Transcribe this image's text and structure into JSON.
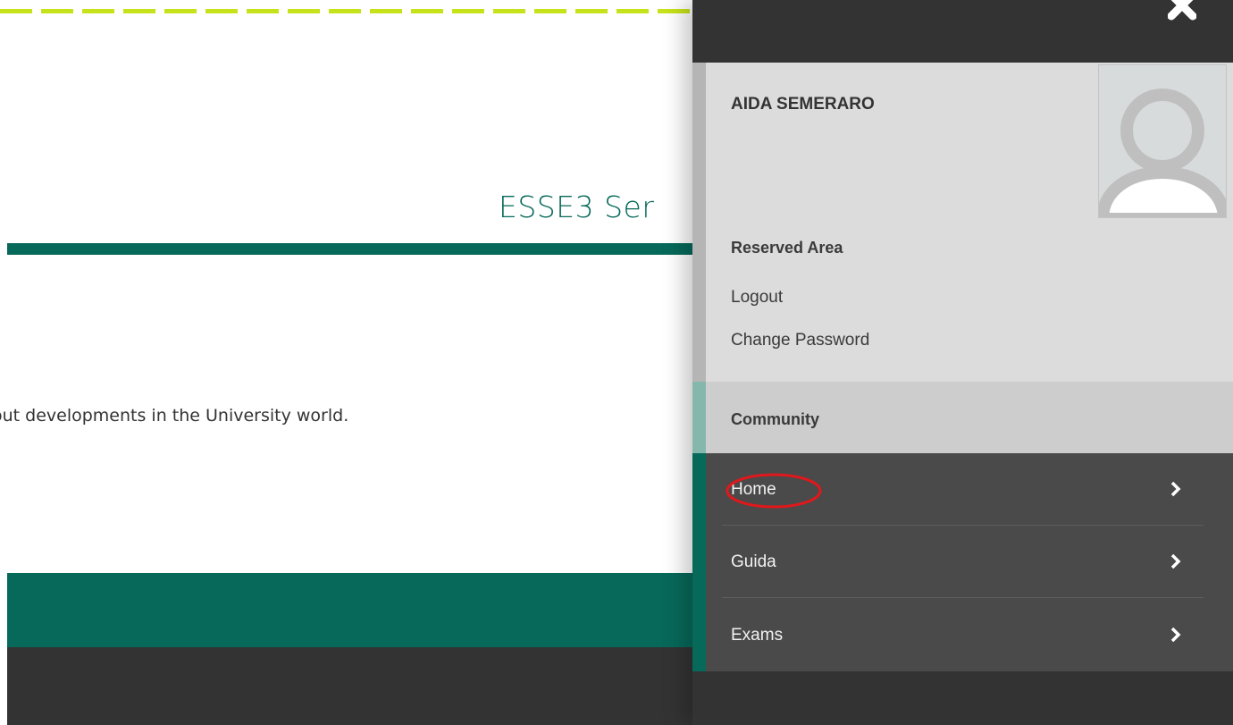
{
  "page": {
    "title": "ESSE3 Ser",
    "body_text": "out developments in the University world.",
    "colors": {
      "brand_green": "#07695a",
      "accent_lime": "#c6e21a",
      "dark": "#333333"
    }
  },
  "drawer": {
    "close_icon": "close-icon",
    "user": {
      "name": "AIDA SEMERARO",
      "avatar_icon": "user-avatar-placeholder"
    },
    "reserved_area": {
      "title": "Reserved Area",
      "links": [
        "Logout",
        "Change Password"
      ]
    },
    "community": {
      "title": "Community",
      "items": [
        {
          "label": "Home",
          "icon": "chevron-right-icon",
          "highlighted": true
        },
        {
          "label": "Guida",
          "icon": "chevron-right-icon"
        },
        {
          "label": "Exams",
          "icon": "chevron-right-icon"
        }
      ],
      "highlight_color": "#e0181b"
    }
  }
}
